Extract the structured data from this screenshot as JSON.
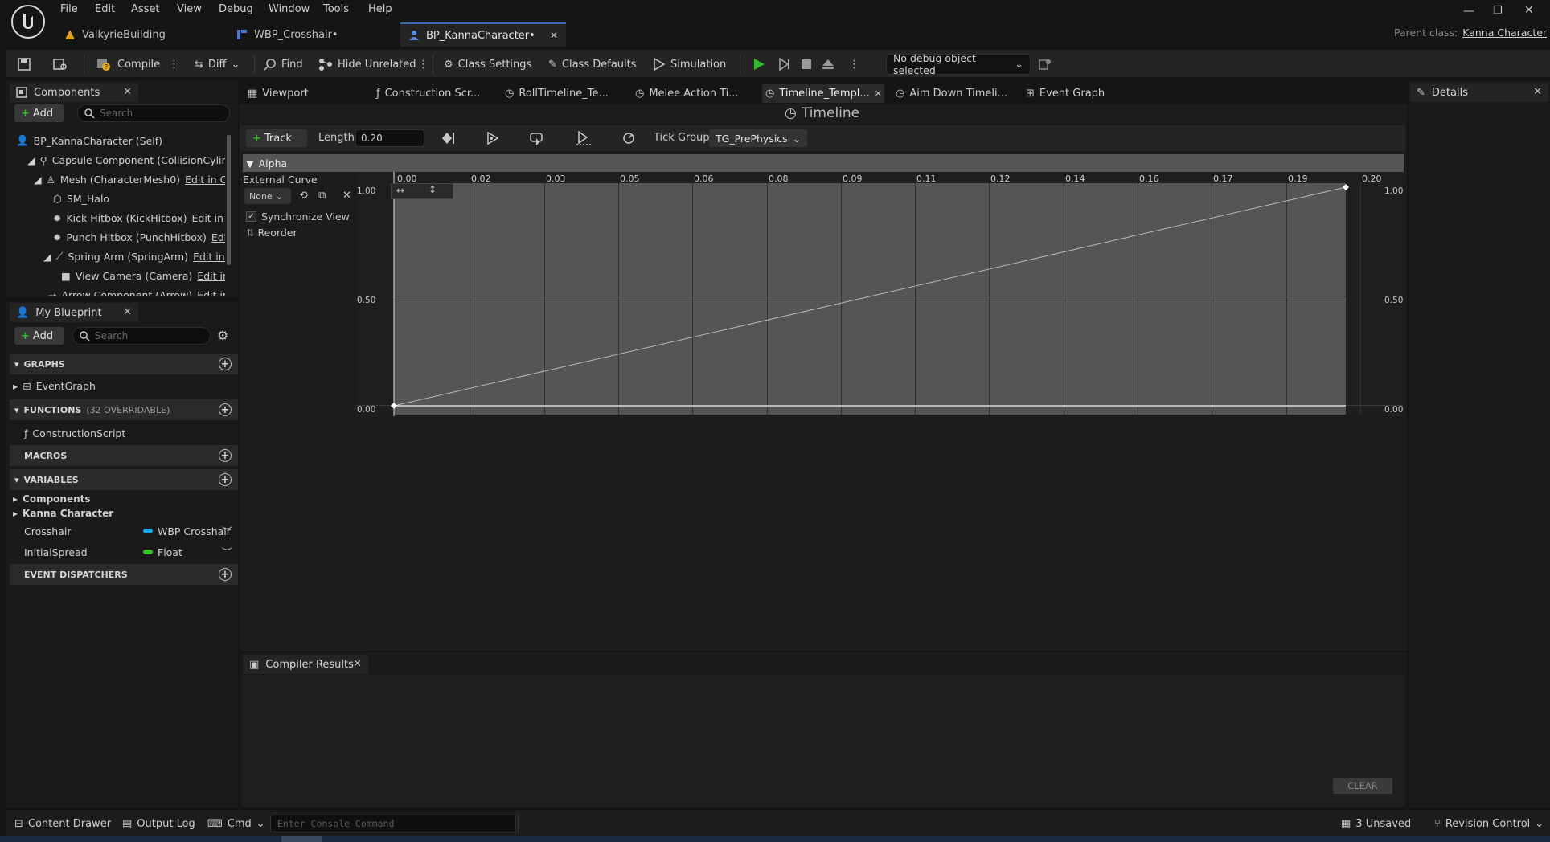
{
  "app": {
    "logo": "unreal-engine-logo"
  },
  "menu": [
    "File",
    "Edit",
    "Asset",
    "View",
    "Debug",
    "Window",
    "Tools",
    "Help"
  ],
  "doc_tabs": [
    {
      "label": "ValkyrieBuilding",
      "icon": "level-icon"
    },
    {
      "label": "WBP_Crosshair•",
      "icon": "widget-blueprint-icon"
    },
    {
      "label": "BP_KannaCharacter•",
      "icon": "blueprint-icon"
    }
  ],
  "parent_class": {
    "label": "Parent class:",
    "value": "Kanna Character"
  },
  "window_controls": [
    "minimize",
    "restore",
    "close"
  ],
  "toolbar": {
    "compile": "Compile",
    "diff": "Diff",
    "find": "Find",
    "hide_unrelated": "Hide Unrelated",
    "class_settings": "Class Settings",
    "class_defaults": "Class Defaults",
    "simulation": "Simulation",
    "debug_object": "No debug object selected"
  },
  "components_panel": {
    "title": "Components",
    "add": "Add",
    "search_placeholder": "Search",
    "items": [
      {
        "label": "BP_KannaCharacter (Self)",
        "edit": ""
      },
      {
        "label": "Capsule Component (CollisionCylinder)",
        "edit": ""
      },
      {
        "label": "Mesh (CharacterMesh0)",
        "edit": "Edit in C++"
      },
      {
        "label": "SM_Halo",
        "edit": ""
      },
      {
        "label": "Kick Hitbox (KickHitbox)",
        "edit": "Edit in C++"
      },
      {
        "label": "Punch Hitbox (PunchHitbox)",
        "edit": "Edit in C++"
      },
      {
        "label": "Spring Arm (SpringArm)",
        "edit": "Edit in C++"
      },
      {
        "label": "View Camera (Camera)",
        "edit": "Edit in C++"
      },
      {
        "label": "Arrow Component (Arrow)",
        "edit": "Edit in C++"
      }
    ]
  },
  "my_blueprint": {
    "title": "My Blueprint",
    "add": "Add",
    "search_placeholder": "Search",
    "graphs": "GRAPHS",
    "event_graph": "EventGraph",
    "functions": "FUNCTIONS",
    "functions_note": "(32 OVERRIDABLE)",
    "construction_script": "ConstructionScript",
    "macros": "MACROS",
    "variables": "VARIABLES",
    "var_groups": [
      "Components",
      "Kanna Character"
    ],
    "vars": [
      {
        "name": "Crosshair",
        "type": "WBP Crosshair",
        "color": "#1fa6e8"
      },
      {
        "name": "InitialSpread",
        "type": "Float",
        "color": "#36c02a"
      }
    ],
    "event_dispatchers": "EVENT DISPATCHERS"
  },
  "graph_tabs": [
    "Viewport",
    "Construction Scr...",
    "RollTimeline_Te...",
    "Melee Action Ti...",
    "Timeline_Templ...",
    "Aim Down Timeli...",
    "Event Graph"
  ],
  "timeline": {
    "title": "Timeline",
    "track_btn": "Track",
    "length_label": "Length",
    "length_value": "0.20",
    "tick_group_label": "Tick Group",
    "tick_group_value": "TG_PrePhysics",
    "track_name": "Alpha",
    "external_curve": "External Curve",
    "curve_none": "None",
    "sync_view": "Synchronize View",
    "reorder": "Reorder",
    "x_ticks": [
      "0.00",
      "0.02",
      "0.03",
      "0.05",
      "0.06",
      "0.08",
      "0.09",
      "0.11",
      "0.12",
      "0.14",
      "0.16",
      "0.17",
      "0.19",
      "0.20"
    ],
    "y_left": [
      "1.00",
      "0.50",
      "0.00"
    ],
    "y_right": [
      "1.00",
      "0.50",
      "0.00"
    ],
    "curve": {
      "start": [
        0,
        0
      ],
      "end": [
        0.2,
        1
      ]
    }
  },
  "compiler": {
    "title": "Compiler Results",
    "clear": "CLEAR"
  },
  "details": {
    "title": "Details"
  },
  "statusbar": {
    "content_drawer": "Content Drawer",
    "output_log": "Output Log",
    "cmd": "Cmd",
    "console_placeholder": "Enter Console Command",
    "unsaved": "3 Unsaved",
    "revision_control": "Revision Control"
  },
  "colors": {
    "accent": "#3a6ab0",
    "play": "#2fb82a"
  }
}
